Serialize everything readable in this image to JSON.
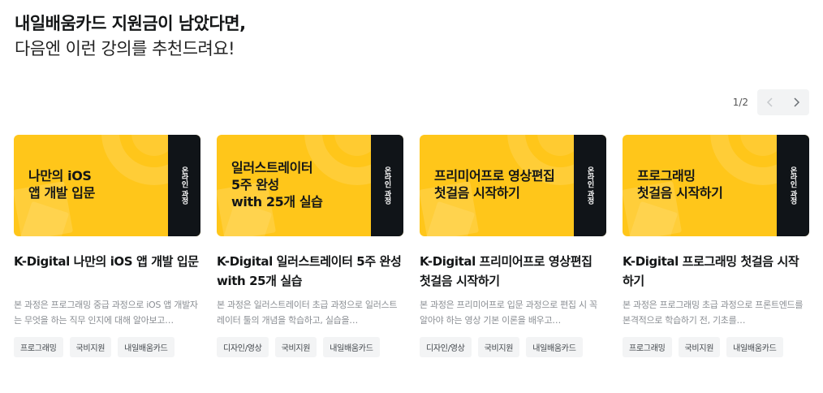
{
  "heading": {
    "line1": "내일배움카드 지원금이 남았다면,",
    "line2": "다음엔 이런 강의를 추천드려요!"
  },
  "pager": {
    "count": "1/2",
    "prev_icon": "chevron-left-icon",
    "next_icon": "chevron-right-icon"
  },
  "colors": {
    "thumb_bg": "#ffc61a",
    "band_bg": "#101418",
    "tag_bg": "#f3f4f5"
  },
  "cards": [
    {
      "thumb_title": "나만의 iOS\n앱 개발 입문",
      "band_label": "온라인 과정",
      "title": "K-Digital 나만의 iOS 앱 개발 입문",
      "desc": "본 과정은 프로그래밍 중급 과정으로 iOS 앱 개발자는 무엇을 하는 직무 인지에 대해 알아보고…",
      "tags": [
        "프로그래밍",
        "국비지원",
        "내일배움카드"
      ]
    },
    {
      "thumb_title": "일러스트레이터\n5주 완성\nwith 25개 실습",
      "band_label": "온라인 과정",
      "title": "K-Digital 일러스트레이터 5주 완성 with 25개 실습",
      "desc": "본 과정은 일러스트레이터 초급 과정으로 일러스트레이터 툴의 개념을 학습하고, 실습을…",
      "tags": [
        "디자인/영상",
        "국비지원",
        "내일배움카드"
      ]
    },
    {
      "thumb_title": "프리미어프로 영상편집\n첫걸음 시작하기",
      "band_label": "온라인 과정",
      "title": "K-Digital 프리미어프로 영상편집 첫걸음 시작하기",
      "desc": "본 과정은 프리미어프로 입문 과정으로 편집 시 꼭 알아야 하는 영상 기본 이론을 배우고…",
      "tags": [
        "디자인/영상",
        "국비지원",
        "내일배움카드"
      ]
    },
    {
      "thumb_title": "프로그래밍\n첫걸음 시작하기",
      "band_label": "온라인 과정",
      "title": "K-Digital 프로그래밍 첫걸음 시작하기",
      "desc": "본 과정은 프로그래밍 초급 과정으로 프론트엔드를 본격적으로 학습하기 전, 기초를…",
      "tags": [
        "프로그래밍",
        "국비지원",
        "내일배움카드"
      ]
    }
  ]
}
